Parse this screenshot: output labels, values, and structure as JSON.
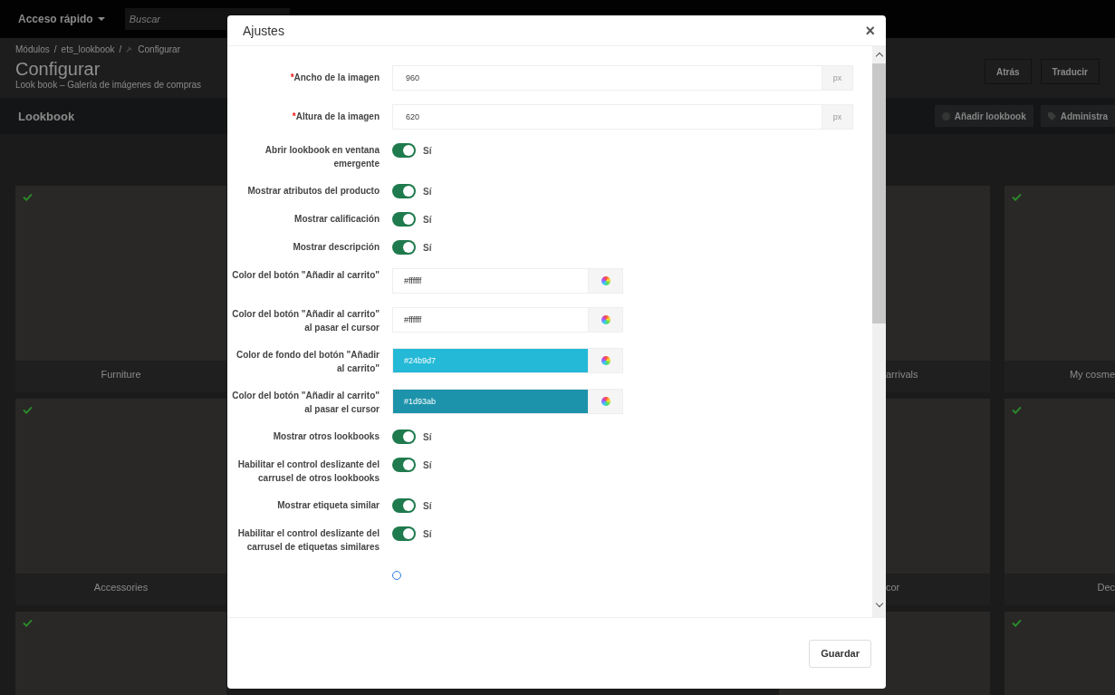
{
  "topbar": {
    "quick_access": "Acceso rápido",
    "search": {
      "placeholder": "Buscar"
    }
  },
  "breadcrumb": {
    "separator": "/",
    "items": [
      "Módulos",
      "ets_lookbook",
      "Configurar"
    ]
  },
  "page": {
    "title": "Configurar",
    "subtitle": "Look book – Galería de imágenes de compras",
    "buttons": [
      "Atrás",
      "Traducir"
    ]
  },
  "section": {
    "title": "Lookbook",
    "buttons": [
      "Añadir lookbook",
      "Administra"
    ]
  },
  "lookbook_rows": [
    {
      "column_1": {
        "label": "Furniture",
        "checked": true
      },
      "column_4": {
        "label": "arrivals"
      },
      "column_5": {
        "label": "My cosme",
        "checked": true
      }
    },
    {
      "column_1": {
        "label": "Accessories",
        "checked": true
      },
      "column_4": {
        "label": "cor"
      },
      "column_5": {
        "label": "Dec",
        "checked": true
      }
    },
    {
      "column_1": {
        "checked": true
      },
      "column_5": {
        "checked": true
      }
    }
  ],
  "dialog": {
    "title": "Ajustes",
    "close": "×",
    "save": "Guardar",
    "fields": [
      {
        "kind": "number",
        "label": "Ancho de la imagen",
        "required_mark": "*",
        "value": "960",
        "unit": "px"
      },
      {
        "kind": "number",
        "label": "Altura de la imagen",
        "required_mark": "*",
        "value": "620",
        "unit": "px"
      },
      {
        "kind": "toggle",
        "label": "Abrir lookbook en ventana emergente",
        "on": true,
        "text": "Sí"
      },
      {
        "kind": "toggle",
        "label": "Mostrar atributos del producto",
        "on": true,
        "text": "Sí"
      },
      {
        "kind": "toggle",
        "label": "Mostrar calificación",
        "on": true,
        "text": "Sí"
      },
      {
        "kind": "toggle",
        "label": "Mostrar descripción",
        "on": true,
        "text": "Sí"
      },
      {
        "kind": "color",
        "label": "Color del botón \"Añadir al carrito\"",
        "value": "#ffffff",
        "color": "#ffffff"
      },
      {
        "kind": "color",
        "label": "Color del botón \"Añadir al carrito\" al pasar el cursor",
        "value": "#ffffff",
        "color": "#ffffff"
      },
      {
        "kind": "color",
        "label": "Color de fondo del botón \"Añadir al carrito\"",
        "value": "#24b9d7",
        "color": "#24b9d7"
      },
      {
        "kind": "color",
        "label": "Color del botón \"Añadir al carrito\" al pasar el cursor",
        "value": "#1d93ab",
        "color": "#1d93ab"
      },
      {
        "kind": "toggle",
        "label": "Mostrar otros lookbooks",
        "on": true,
        "text": "Sí"
      },
      {
        "kind": "toggle",
        "label": "Habilitar el control deslizante del carrusel de otros lookbooks",
        "on": true,
        "text": "Sí"
      },
      {
        "kind": "toggle",
        "label": "Mostrar etiqueta similar",
        "on": true,
        "text": "Sí"
      },
      {
        "kind": "toggle",
        "label": "Habilitar el control deslizante del carrusel de etiquetas similares",
        "on": true,
        "text": "Sí"
      }
    ]
  }
}
